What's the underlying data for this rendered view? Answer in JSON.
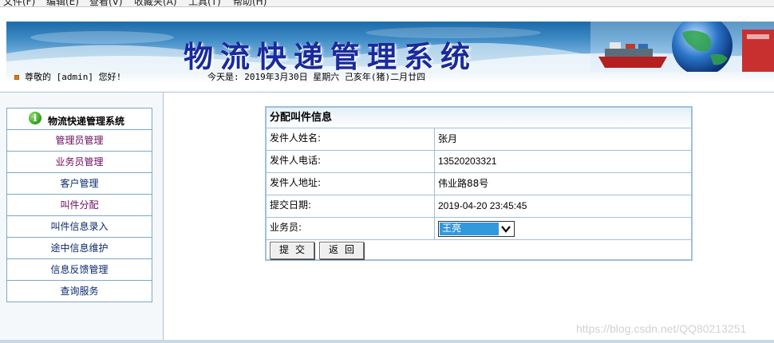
{
  "browser": {
    "menu": [
      "文件(F)",
      "编辑(E)",
      "查看(V)",
      "收藏夹(A)",
      "工具(T)",
      "帮助(H)"
    ]
  },
  "banner": {
    "title": "物流快递管理系统",
    "greeting": "尊敬的 [admin] 您好!",
    "date": "今天是: 2019年3月30日 星期六 己亥年(猪)二月廿四"
  },
  "sidebar": {
    "header": "物流快递管理系统",
    "items": [
      {
        "label": "管理员管理",
        "color": "#6b0a5a"
      },
      {
        "label": "业务员管理",
        "color": "#6b0a5a"
      },
      {
        "label": "客户管理",
        "color": "#0a2a6b"
      },
      {
        "label": "叫件分配",
        "color": "#6b0a5a"
      },
      {
        "label": "叫件信息录入",
        "color": "#0a2a6b"
      },
      {
        "label": "途中信息维护",
        "color": "#0a2a6b"
      },
      {
        "label": "信息反馈管理",
        "color": "#0a2a6b"
      },
      {
        "label": "查询服务",
        "color": "#0a2a6b"
      }
    ]
  },
  "form": {
    "title": "分配叫件信息",
    "fields": [
      {
        "label": "发件人姓名:",
        "value": "张月"
      },
      {
        "label": "发件人电话:",
        "value": "13520203321"
      },
      {
        "label": "发件人地址:",
        "value": "伟业路88号"
      },
      {
        "label": "提交日期:",
        "value": "2019-04-20 23:45:45"
      }
    ],
    "staff_label": "业务员:",
    "staff_selected": "王亮",
    "submit_label": "提交",
    "back_label": "返回"
  },
  "watermark": "https://blog.csdn.net/QQ80213251",
  "colors": {
    "border": "#9dc0dc",
    "select_highlight": "#3399dd"
  }
}
